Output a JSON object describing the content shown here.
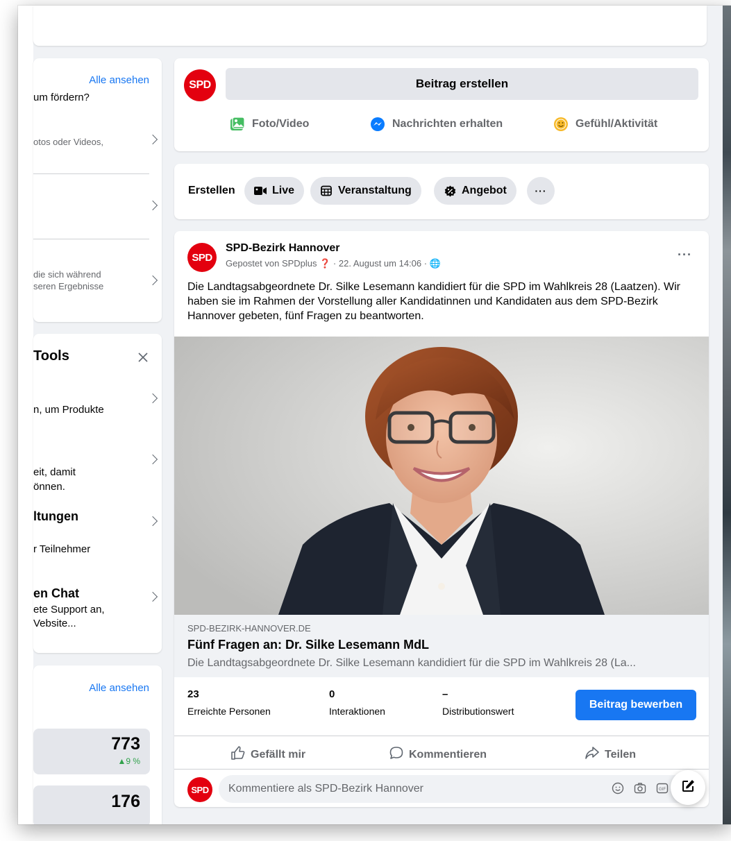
{
  "left_panel": {
    "card1": {
      "see_all": "Alle ansehen",
      "subtitle": "um fördern?",
      "item1": "otos oder Videos,",
      "item3_line1": "die sich während",
      "item3_line2": "seren Ergebnisse"
    },
    "tools": {
      "title": "Tools",
      "close_icon": "close-icon",
      "item1": "n, um Produkte",
      "item2_line1": "eit, damit",
      "item2_line2": "önnen.",
      "item3_title": "ltungen",
      "item3_sub": "r Teilnehmer",
      "item4_title": "en Chat",
      "item4_line1": "ete Support an,",
      "item4_line2": "Vebsite..."
    },
    "insights": {
      "see_all": "Alle ansehen",
      "value1": "773",
      "change1": "▲9 %",
      "value2": "176"
    }
  },
  "composer": {
    "logo_text": "SPD",
    "create_label": "Beitrag erstellen",
    "actions": [
      {
        "label": "Foto/Video",
        "icon": "photo-video-icon",
        "color": "#45bd62"
      },
      {
        "label": "Nachrichten erhalten",
        "icon": "messenger-icon",
        "color": "#0a7cff"
      },
      {
        "label": "Gefühl/Aktivität",
        "icon": "feeling-icon",
        "color": "#f7b928"
      }
    ]
  },
  "create_bar": {
    "label": "Erstellen",
    "pills": [
      {
        "label": "Live",
        "icon": "live-video-icon"
      },
      {
        "label": "Veranstaltung",
        "icon": "calendar-icon"
      },
      {
        "label": "Angebot",
        "icon": "offer-icon"
      }
    ],
    "more": "···"
  },
  "post": {
    "author": "SPD-Bezirk Hannover",
    "meta": "Gepostet von SPDplus ❓ · 22. August um 14:06 · 🌐",
    "more": "···",
    "text": "Die Landtagsabgeordnete Dr. Silke Lesemann kandidiert für die SPD im Wahlkreis 28 (Laatzen). Wir haben sie im Rahmen der Vorstellung aller Kandidatinnen und Kandidaten aus dem SPD-Bezirk Hannover gebeten, fünf Fragen zu beantworten.",
    "link": {
      "domain": "SPD-BEZIRK-HANNOVER.DE",
      "title": "Fünf Fragen an: Dr. Silke Lesemann MdL",
      "description": "Die Landtagsabgeordnete Dr. Silke Lesemann kandidiert für die SPD im Wahlkreis 28 (La..."
    },
    "stats": [
      {
        "value": "23",
        "label": "Erreichte Personen"
      },
      {
        "value": "0",
        "label": "Interaktionen"
      },
      {
        "value": "–",
        "label": "Distributionswert"
      }
    ],
    "promote_label": "Beitrag bewerben",
    "actions": {
      "like": "Gefällt mir",
      "comment": "Kommentieren",
      "share": "Teilen"
    },
    "comment_placeholder": "Kommentiere als SPD-Bezirk Hannover"
  },
  "colors": {
    "brand": "#e3000f",
    "accent": "#1877f2"
  }
}
